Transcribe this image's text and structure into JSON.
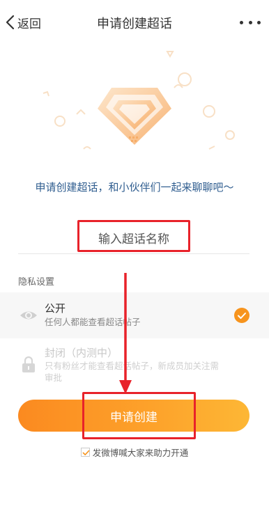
{
  "nav": {
    "back_label": "返回",
    "title": "申请创建超话"
  },
  "intro_text": "申请创建超话，和小伙伴们一起来聊聊吧～",
  "name_input": {
    "placeholder": "输入超话名称",
    "value": ""
  },
  "privacy": {
    "section_label": "隐私设置",
    "options": [
      {
        "title": "公开",
        "description": "任何人都能查看超话帖子",
        "selected": true,
        "icon": "eye-icon"
      },
      {
        "title": "封闭（内测中）",
        "description": "只有粉丝才能查看超话帖子，新成员加关注需审批",
        "selected": false,
        "icon": "lock-icon"
      }
    ]
  },
  "create_button_label": "申请创建",
  "share": {
    "label": "发微博喊大家来助力开通",
    "checked": true
  },
  "colors": {
    "accent_orange": "#f7941d",
    "intro_blue": "#2f5d8f",
    "annotation_red": "#e8222a"
  }
}
